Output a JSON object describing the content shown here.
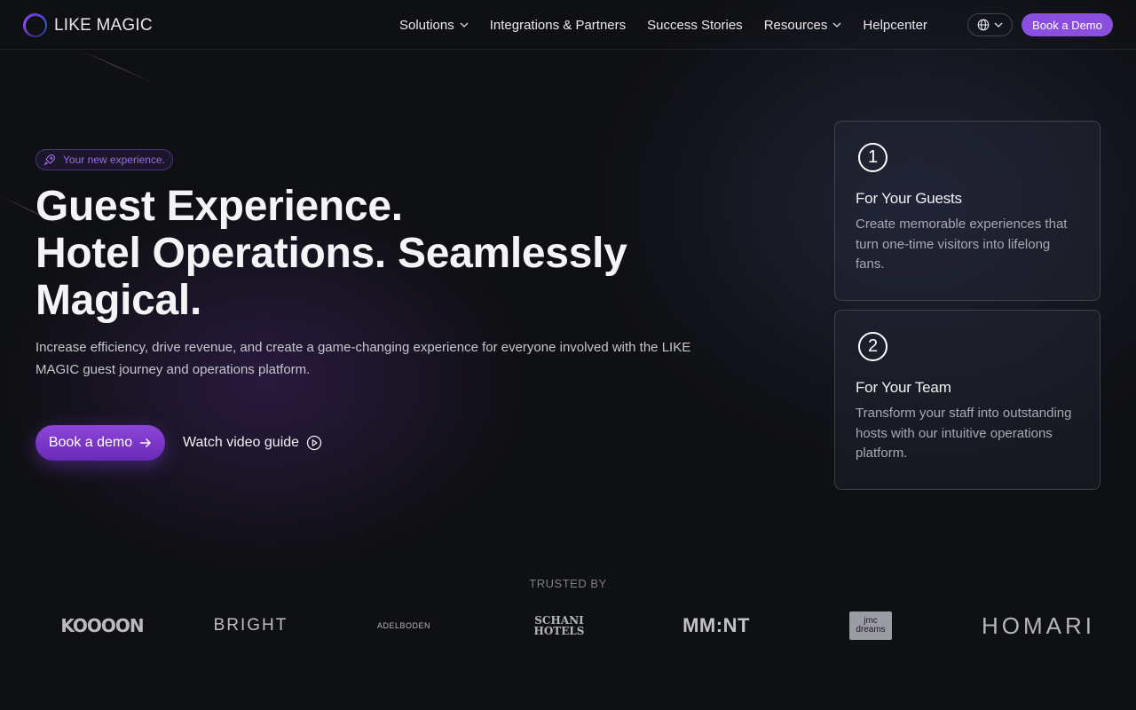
{
  "brand": {
    "name": "LIKE MAGIC"
  },
  "nav": {
    "items": [
      {
        "label": "Solutions",
        "dropdown": true
      },
      {
        "label": "Integrations & Partners",
        "dropdown": false
      },
      {
        "label": "Success Stories",
        "dropdown": false
      },
      {
        "label": "Resources",
        "dropdown": true
      },
      {
        "label": "Helpcenter",
        "dropdown": false
      }
    ],
    "book_demo": "Book a Demo"
  },
  "hero": {
    "badge": "Your new experience.",
    "title_lines": [
      "Guest Experience.",
      "Hotel Operations. Seamlessly",
      "Magical."
    ],
    "subtitle": "Increase efficiency, drive revenue, and create a game-changing experience for everyone involved with the LIKE MAGIC guest journey and operations platform.",
    "cta_primary": "Book a demo",
    "cta_secondary": "Watch video guide"
  },
  "cards": [
    {
      "number": "1",
      "title": "For Your Guests",
      "text": "Create memorable experiences that turn one-time visitors into lifelong fans."
    },
    {
      "number": "2",
      "title": "For Your Team",
      "text": "Transform your staff into outstanding hosts with our intuitive operations platform."
    }
  ],
  "trusted": {
    "label": "TRUSTED BY",
    "logos": [
      "KOOOON",
      "BRIGHT",
      "ADELBODEN",
      "SCHANI HOTELS",
      "MM:NT",
      "jmc dreams",
      "HOMARI"
    ]
  },
  "colors": {
    "accent": "#8a4fe0",
    "background": "#0f1013",
    "card_border": "#3a3c46"
  }
}
